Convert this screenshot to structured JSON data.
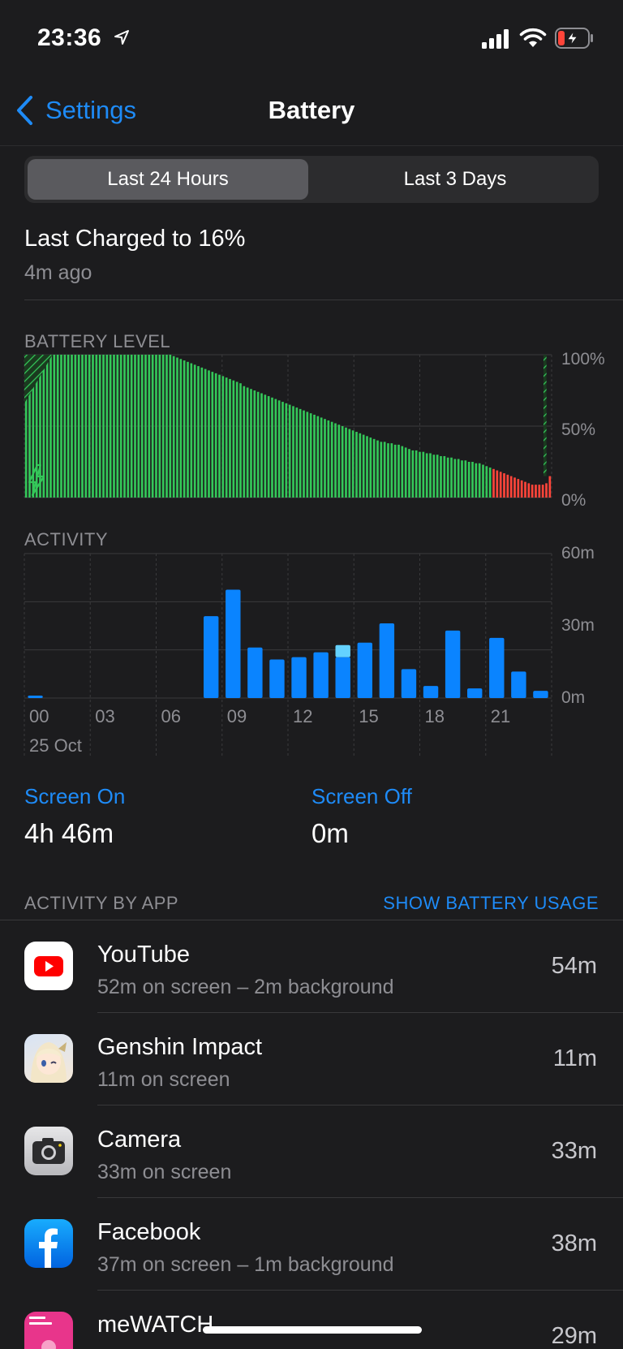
{
  "status_bar": {
    "time": "23:36"
  },
  "nav": {
    "back_label": "Settings",
    "title": "Battery"
  },
  "segments": {
    "active": "Last 24 Hours",
    "inactive": "Last 3 Days"
  },
  "last_charged": {
    "title": "Last Charged to 16%",
    "ago": "4m ago"
  },
  "battery_section_label": "BATTERY LEVEL",
  "activity_section_label": "ACTIVITY",
  "colors": {
    "green": "#34c759",
    "red": "#ff453a",
    "blue": "#0a84ff",
    "light_blue": "#64d2ff",
    "accent": "#1e8bf7"
  },
  "chart_data": [
    {
      "type": "bar",
      "title": "BATTERY LEVEL",
      "y_tick_labels": [
        "100%",
        "50%",
        "0%"
      ],
      "ylim": [
        0,
        100
      ],
      "grid": true,
      "legend": "none",
      "values": [
        100,
        100,
        100,
        100,
        100,
        100,
        100,
        100,
        100,
        100,
        100,
        100,
        100,
        100,
        100,
        100,
        100,
        100,
        100,
        100,
        100,
        100,
        100,
        100,
        100,
        100,
        100,
        100,
        100,
        100,
        100,
        100,
        100,
        100,
        100,
        100,
        100,
        100,
        100,
        100,
        100,
        100,
        99,
        98,
        97,
        96,
        95,
        94,
        93,
        92,
        91,
        90,
        89,
        88,
        87,
        86,
        85,
        84,
        83,
        82,
        81,
        80,
        78,
        77,
        76,
        75,
        74,
        73,
        72,
        71,
        70,
        69,
        68,
        67,
        66,
        65,
        64,
        63,
        62,
        61,
        60,
        59,
        58,
        57,
        56,
        55,
        54,
        53,
        52,
        51,
        50,
        49,
        48,
        47,
        46,
        45,
        44,
        43,
        42,
        41,
        40,
        39,
        39,
        38,
        38,
        37,
        37,
        36,
        35,
        34,
        33,
        33,
        32,
        32,
        31,
        31,
        30,
        30,
        29,
        29,
        28,
        28,
        27,
        27,
        26,
        26,
        25,
        25,
        24,
        24,
        23,
        22,
        21,
        20,
        19,
        18,
        17,
        16,
        15,
        14,
        13,
        12,
        11,
        10,
        9,
        9,
        9,
        9,
        10,
        15
      ],
      "charging_start_bars": 8,
      "low_threshold": 20
    },
    {
      "type": "bar",
      "title": "ACTIVITY",
      "categories": [
        "00",
        "01",
        "02",
        "03",
        "04",
        "05",
        "06",
        "07",
        "08",
        "09",
        "10",
        "11",
        "12",
        "13",
        "14",
        "15",
        "16",
        "17",
        "18",
        "19",
        "20",
        "21",
        "22",
        "23"
      ],
      "x_tick_labels": [
        "00",
        "03",
        "06",
        "09",
        "12",
        "15",
        "18",
        "21"
      ],
      "date_label": "25 Oct",
      "y_tick_labels": [
        "60m",
        "30m",
        "0m"
      ],
      "ylim": [
        0,
        60
      ],
      "series": [
        {
          "values": [
            1,
            0,
            0,
            0,
            0,
            0,
            0,
            0,
            34,
            45,
            21,
            16,
            17,
            19,
            17,
            23,
            31,
            12,
            5,
            28,
            4,
            25,
            11,
            3
          ]
        },
        {
          "values": [
            0,
            0,
            0,
            0,
            0,
            0,
            0,
            0,
            0,
            0,
            0,
            0,
            0,
            0,
            5,
            0,
            0,
            0,
            0,
            0,
            0,
            0,
            0,
            0
          ]
        }
      ]
    }
  ],
  "screen_on": {
    "label": "Screen On",
    "value": "4h 46m"
  },
  "screen_off": {
    "label": "Screen Off",
    "value": "0m"
  },
  "activity_by_app": {
    "label": "ACTIVITY BY APP",
    "action": "SHOW BATTERY USAGE"
  },
  "apps": [
    {
      "name": "YouTube",
      "detail": "52m on screen – 2m background",
      "time": "54m"
    },
    {
      "name": "Genshin Impact",
      "detail": "11m on screen",
      "time": "11m"
    },
    {
      "name": "Camera",
      "detail": "33m on screen",
      "time": "33m"
    },
    {
      "name": "Facebook",
      "detail": "37m on screen – 1m background",
      "time": "38m"
    },
    {
      "name": "meWATCH",
      "detail": "",
      "time": "29m"
    }
  ]
}
